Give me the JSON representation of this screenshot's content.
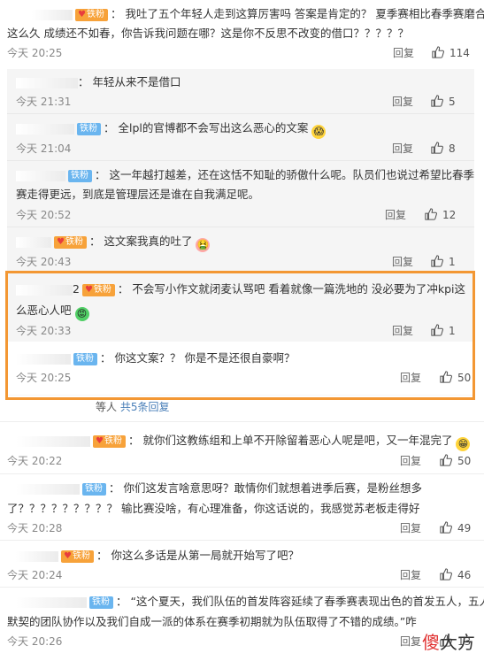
{
  "badge_label": "铁粉",
  "reply_label": "回复",
  "comments": [
    {
      "text1": "我吐了五个年轻人走到这算厉害吗 答案是肯定的？ 夏季赛相比春季赛磨合",
      "text2": "这么久 成绩还不如春，你告诉我问题在哪？这是你不反思不改变的借口？？？？？",
      "time": "今天 20:25",
      "likes": "114"
    },
    {
      "text1": "年轻从来不是借口",
      "time": "今天 21:31",
      "likes": "5"
    },
    {
      "text1": "全lpl的官博都不会写出这么恶心的文案",
      "time": "今天 21:04",
      "likes": "8"
    },
    {
      "text1": "这一年越打越差，还在这恬不知耻的骄傲什么呢。队员们也说过希望比春季",
      "text2": "赛走得更远，到底是管理层还是谁在自我满足呢。",
      "time": "今天 20:52",
      "likes": "12"
    },
    {
      "text1": "这文案我真的吐了",
      "time": "今天 20:43",
      "likes": "1"
    },
    {
      "prefix": "2",
      "text1": "不会写小作文就闭麦认骂吧 看着就像一篇洗地的  没必要为了冲kpi这",
      "text2": "么恶心人吧",
      "time": "今天 20:33",
      "likes": "1"
    },
    {
      "text1": "你这文案？？ 你是不是还很自豪啊？",
      "time": "今天 20:25",
      "likes": "50"
    },
    {
      "text1": "就你们这教练组和上单不开除留着恶心人呢是吧，又一年混完了",
      "time": "今天 20:22",
      "likes": "50"
    },
    {
      "text1": "你们这发言啥意思呀？敢情你们就想着进季后赛，是粉丝想多",
      "text2": "了？？？？？？？？？ 输比赛没啥，有心理准备，你这话说的，我感觉苏老板走得好",
      "time": "今天 20:28",
      "likes": "49"
    },
    {
      "text1": "你这么多话是从第一局就开始写了吧？",
      "time": "今天 20:24",
      "likes": "46"
    },
    {
      "text1": "“这个夏天，我们队伍的首发阵容延续了春季赛表现出色的首发五人，五人",
      "text2": "默契的团队协作以及我们自成一派的体系在赛季初期就为队伍取得了不错的成绩。”咋",
      "time": "今天 20:26",
      "likes": "13"
    }
  ],
  "more_replies": {
    "prefix": "等人",
    "link": "共5条回复"
  },
  "watermark": {
    "a": "傻",
    "b": "大方"
  }
}
